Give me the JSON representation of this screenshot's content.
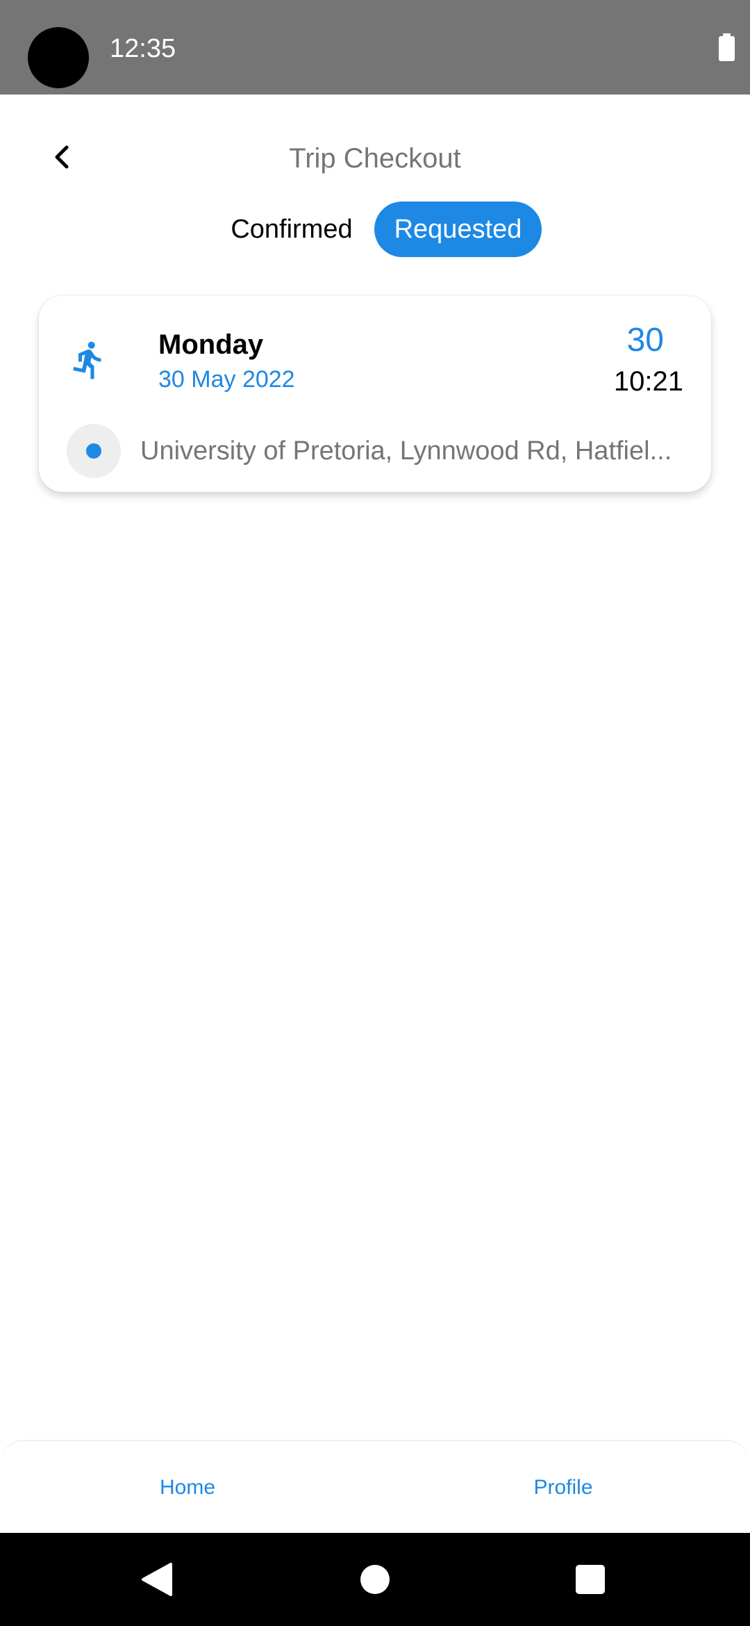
{
  "status_bar": {
    "time": "12:35",
    "icons": [
      "camera-dot",
      "battery-icon"
    ]
  },
  "header": {
    "title": "Trip Checkout",
    "back_icon": "chevron-left-icon"
  },
  "tabs": [
    {
      "label": "Confirmed",
      "active": false
    },
    {
      "label": "Requested",
      "active": true
    }
  ],
  "trip": {
    "icon": "running-person-icon",
    "day": "Monday",
    "date": "30 May 2022",
    "day_number": "30",
    "time": "10:21",
    "location": "University of Pretoria, Lynnwood Rd, Hatfiel..."
  },
  "bottom_nav": {
    "home_label": "Home",
    "profile_label": "Profile"
  },
  "system_nav": {
    "icons": [
      "back-triangle-icon",
      "home-circle-icon",
      "recents-square-icon"
    ]
  },
  "colors": {
    "accent": "#1e88e5",
    "status_bar": "#757575",
    "muted_text": "#757575"
  }
}
